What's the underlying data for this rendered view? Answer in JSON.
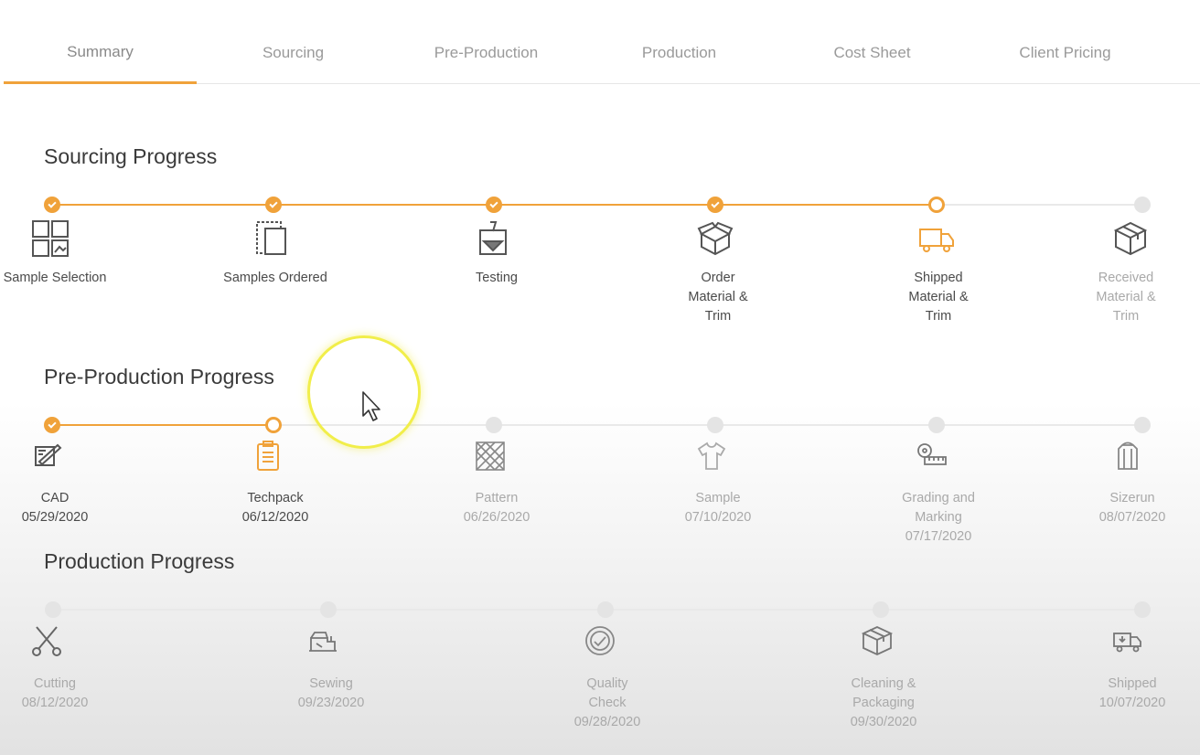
{
  "tabs": [
    {
      "label": "Summary",
      "active": true
    },
    {
      "label": "Sourcing",
      "active": false
    },
    {
      "label": "Pre-Production",
      "active": false
    },
    {
      "label": "Production",
      "active": false
    },
    {
      "label": "Cost Sheet",
      "active": false
    },
    {
      "label": "Client Pricing",
      "active": false
    }
  ],
  "sourcing": {
    "title": "Sourcing Progress",
    "steps": [
      {
        "label": "Sample Selection",
        "icon": "grid-image-icon",
        "status": "done"
      },
      {
        "label": "Samples Ordered",
        "icon": "sample-swatch-icon",
        "status": "done"
      },
      {
        "label": "Testing",
        "icon": "beaker-icon",
        "status": "done"
      },
      {
        "label": "Order Material & Trim",
        "icon": "open-box-icon",
        "status": "done"
      },
      {
        "label": "Shipped Material & Trim",
        "icon": "truck-icon",
        "status": "current"
      },
      {
        "label": "Received Material & Trim",
        "icon": "package-icon",
        "status": "pending"
      }
    ]
  },
  "preproduction": {
    "title": "Pre-Production Progress",
    "steps": [
      {
        "label": "CAD",
        "date": "05/29/2020",
        "icon": "cad-icon",
        "status": "done"
      },
      {
        "label": "Techpack",
        "date": "06/12/2020",
        "icon": "clipboard-icon",
        "status": "current"
      },
      {
        "label": "Pattern",
        "date": "06/26/2020",
        "icon": "pattern-icon",
        "status": "pending"
      },
      {
        "label": "Sample",
        "date": "07/10/2020",
        "icon": "shirt-icon",
        "status": "pending"
      },
      {
        "label": "Grading and Marking",
        "date": "07/17/2020",
        "icon": "measuring-tape-icon",
        "status": "pending"
      },
      {
        "label": "Sizerun",
        "date": "08/07/2020",
        "icon": "garment-rack-icon",
        "status": "pending"
      }
    ]
  },
  "production": {
    "title": "Production Progress",
    "steps": [
      {
        "label": "Cutting",
        "date": "08/12/2020",
        "icon": "scissors-icon",
        "status": "pending"
      },
      {
        "label": "Sewing",
        "date": "09/23/2020",
        "icon": "sewing-machine-icon",
        "status": "pending"
      },
      {
        "label": "Quality Check",
        "date": "09/28/2020",
        "icon": "quality-badge-icon",
        "status": "pending"
      },
      {
        "label": "Cleaning & Packaging",
        "date": "09/30/2020",
        "icon": "box-icon",
        "status": "pending"
      },
      {
        "label": "Shipped",
        "date": "10/07/2020",
        "icon": "delivery-truck-icon",
        "status": "pending"
      }
    ]
  },
  "colors": {
    "accent": "#f0a23a",
    "pending": "#e4e4e4",
    "text": "#4a4a4a",
    "muted": "#a9a9a9"
  }
}
